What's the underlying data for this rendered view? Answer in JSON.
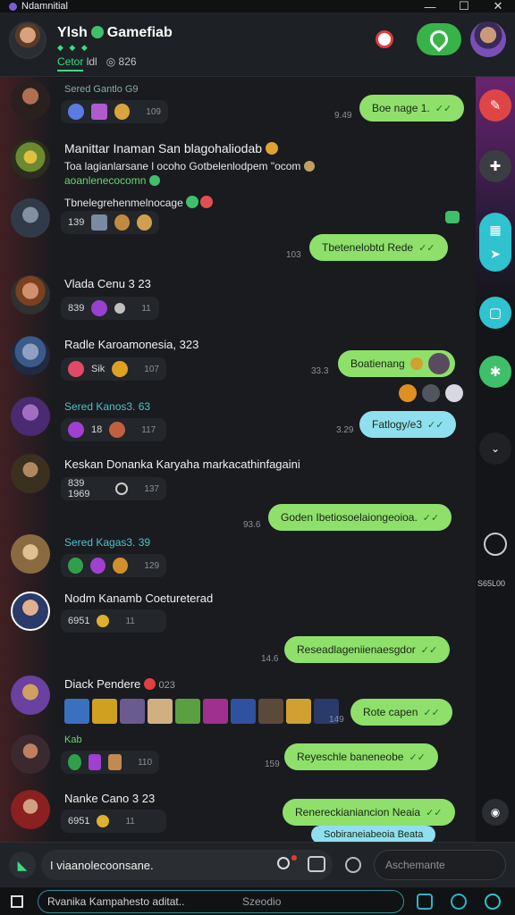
{
  "window": {
    "title": "Ndamnitial",
    "controls": [
      "—",
      "☐",
      "✕"
    ]
  },
  "header": {
    "title": "Ylsh",
    "title_rest": "Gamefiab",
    "dots": "◆ ◆ ◆",
    "status": "Cetor",
    "status_count": "ldl",
    "status_extra": "◎ 826"
  },
  "messages": {
    "m1_name": "Sered Gantlo  G9",
    "m1_time": "109",
    "o1_text": "Boe nage 1.",
    "o1_ticks": "✓✓",
    "o1_time": "9.49",
    "m2_name": "Manittar Inaman San blagohaliodab",
    "m2_line1": "Toa lagianlarsane l ocoho Gotbelenlodpem \"ocom",
    "m2_line2": "aoanlenecocomn",
    "m2_line3": "Tbnelegrehenmelnocage",
    "m2_count": "139",
    "o2_time": "103",
    "o2_text": "Tbetenelobtd Rede",
    "o2_ticks": "✓✓",
    "m3_name": "Vlada Cenu  3  23",
    "m3_count": "839",
    "m3_time": "11",
    "m4_name": "Radle Karoamonesia,  323",
    "m4_count": "Sik",
    "m4_time": "107",
    "o3_time": "33.3",
    "o3_text": "Boatienang",
    "m5_name": "Sered Kanos3.  63",
    "m5_count": "18",
    "m5_time": "117",
    "o4_time": "3.29",
    "o4_text": "Fatlogy/e3",
    "o4_ticks": "✓✓",
    "m6_name": "Keskan Donanka Karyaha markacathinfagaini",
    "m6_count": "839 1969",
    "m6_time": "137",
    "o5_time": "93.6",
    "o5_text": "Goden Ibetiosoelaiongeoioa.",
    "o5_ticks": "✓✓",
    "m7_name": "Sered Kagas3.  39",
    "m7_time": "129",
    "m8_name": "Nodm Kanamb Coetureterad",
    "m8_count": "6951",
    "m8_time": "11",
    "o6_time": "14.6",
    "o6_text": "Reseadlageniienaesgdor",
    "o6_ticks": "✓✓",
    "m9_name": "Diack Pendere",
    "m9_num": "023",
    "o7_time": "149",
    "o7_text": "Rote capen",
    "o7_ticks": "✓✓",
    "m10_name": "Kab",
    "m10_time": "110",
    "o8_time": "159",
    "o8_text": "Reyeschle baneneobe",
    "o8_ticks": "✓✓",
    "m11_name": "Nanke Cano  3  23",
    "m11_count": "6951",
    "m11_time": "11",
    "o9_text": "Renereckianiancion Neaia",
    "o9_ticks": "✓✓",
    "o10_text": "Sobiraneiabeoia Beata"
  },
  "rail": {
    "side_label": "S65L00"
  },
  "input": {
    "placeholder": "I viaanolecoonsane.",
    "search_placeholder": "Aschemante"
  },
  "taskbar": {
    "field_text": "Rvanika Kampahesto aditat..",
    "mid_text": "Szeodio"
  },
  "colors": {
    "outgoing": "#8ee06a",
    "outgoing_alt": "#8fe0ee",
    "accent": "#38b34a",
    "rail_pill": "#2fc3cf"
  }
}
